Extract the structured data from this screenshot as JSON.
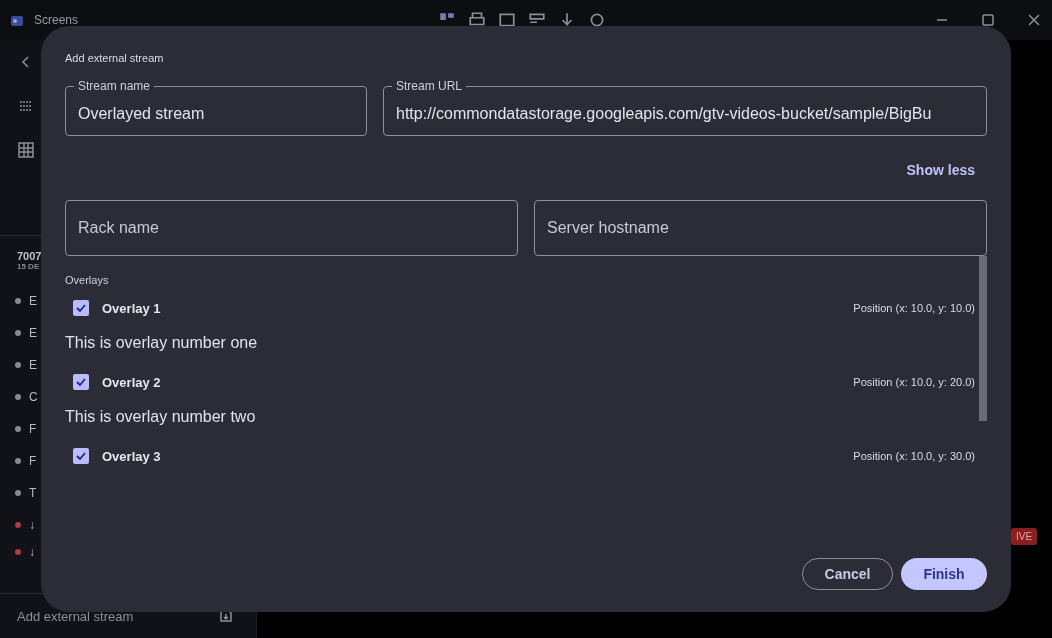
{
  "app": {
    "title": "Screens",
    "sidebar": {
      "header": "7007",
      "subheader": "15 DE",
      "items": [
        {
          "label": "E",
          "alert": false
        },
        {
          "label": "E",
          "alert": false
        },
        {
          "label": "E",
          "alert": false
        },
        {
          "label": "C",
          "alert": false
        },
        {
          "label": "F",
          "alert": false
        },
        {
          "label": "F",
          "alert": false
        },
        {
          "label": "T",
          "alert": false
        },
        {
          "label": "↓",
          "alert": true
        },
        {
          "label": "↓",
          "alert": true
        }
      ],
      "footer": "Add external stream"
    },
    "live_badge": "IVE"
  },
  "dialog": {
    "title": "Add external stream",
    "fields": [
      {
        "label": "Stream name",
        "value": "Overlayed stream"
      },
      {
        "label": "Stream URL",
        "value": "http://commondatastorage.googleapis.com/gtv-videos-bucket/sample/BigBu"
      },
      {
        "placeholder": "Rack name"
      },
      {
        "placeholder": "Server hostname"
      }
    ],
    "toggle_link": "Show less",
    "overlays_label": "Overlays",
    "overlays": [
      {
        "title": "Overlay 1",
        "checked": true,
        "position": "Position (x: 10.0, y: 10.0)",
        "description": "This is overlay number one"
      },
      {
        "title": "Overlay 2",
        "checked": true,
        "position": "Position (x: 10.0, y: 20.0)",
        "description": "This is overlay number two"
      },
      {
        "title": "Overlay 3",
        "checked": true,
        "position": "Position (x: 10.0, y: 30.0)"
      }
    ],
    "buttons": [
      {
        "label": "Cancel",
        "kind": "outlined"
      },
      {
        "label": "Finish",
        "kind": "filled"
      }
    ]
  }
}
